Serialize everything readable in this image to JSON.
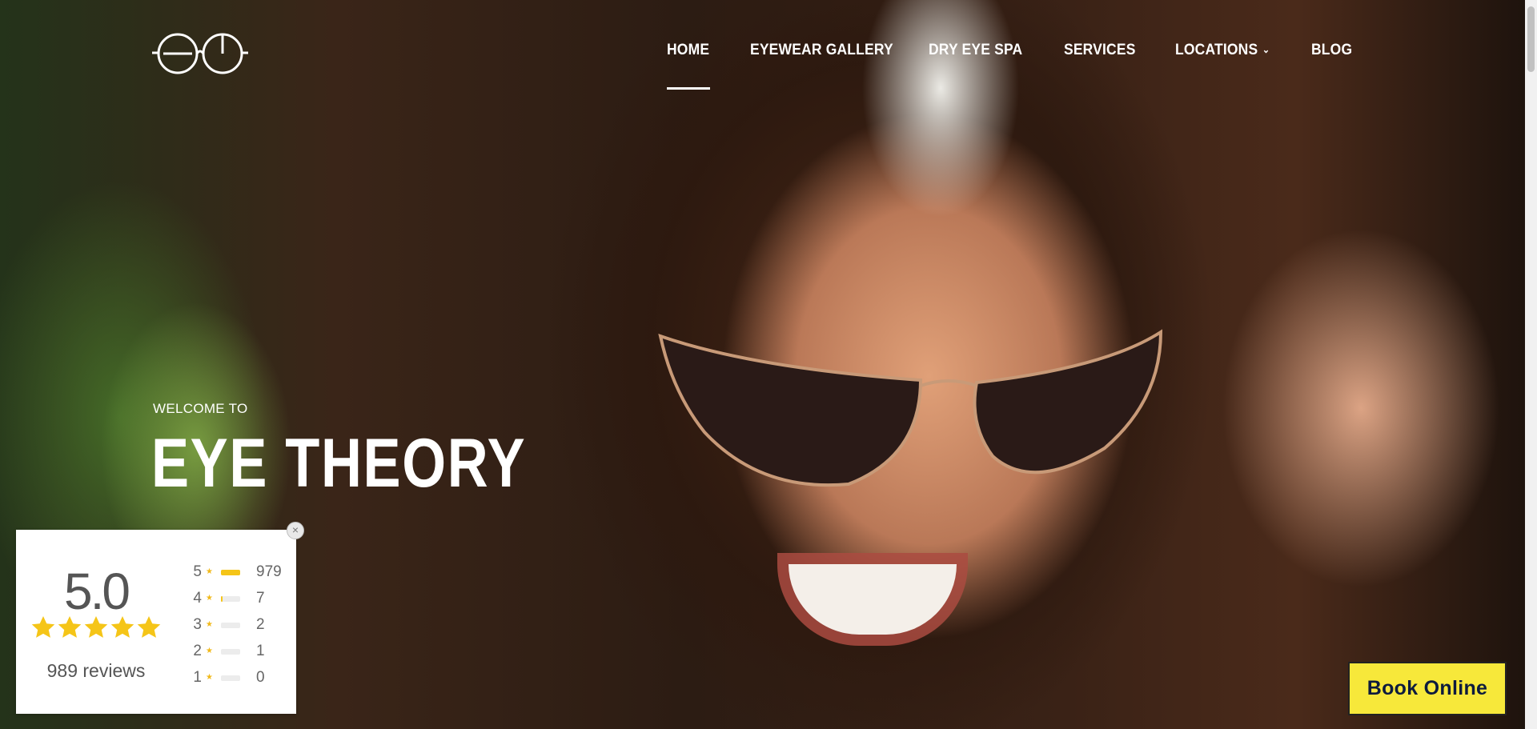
{
  "nav": {
    "items": [
      {
        "label": "HOME",
        "active": true
      },
      {
        "label": "EYEWEAR GALLERY"
      },
      {
        "label": "DRY EYE SPA"
      },
      {
        "label": "SERVICES"
      },
      {
        "label": "LOCATIONS",
        "has_dropdown": true
      },
      {
        "label": "BLOG"
      }
    ]
  },
  "hero": {
    "welcome": "WELCOME TO",
    "title": "EYE THEORY"
  },
  "reviews": {
    "score": "5.0",
    "stars": 5,
    "count_text": "989 reviews",
    "distribution": [
      {
        "stars": "5",
        "count": "979",
        "fraction": 0.99
      },
      {
        "stars": "4",
        "count": "7",
        "fraction": 0.01
      },
      {
        "stars": "3",
        "count": "2",
        "fraction": 0.0
      },
      {
        "stars": "2",
        "count": "1",
        "fraction": 0.0
      },
      {
        "stars": "1",
        "count": "0",
        "fraction": 0.0
      }
    ]
  },
  "cta": {
    "book_label": "Book Online"
  },
  "colors": {
    "accent_yellow": "#f7e83a",
    "star_gold": "#f5c518",
    "cta_text": "#0d1b3e"
  },
  "icons": {
    "logo": "eye-theory-glasses-logo",
    "close": "close-icon",
    "star": "star-icon",
    "dropdown": "chevron-down-icon"
  }
}
